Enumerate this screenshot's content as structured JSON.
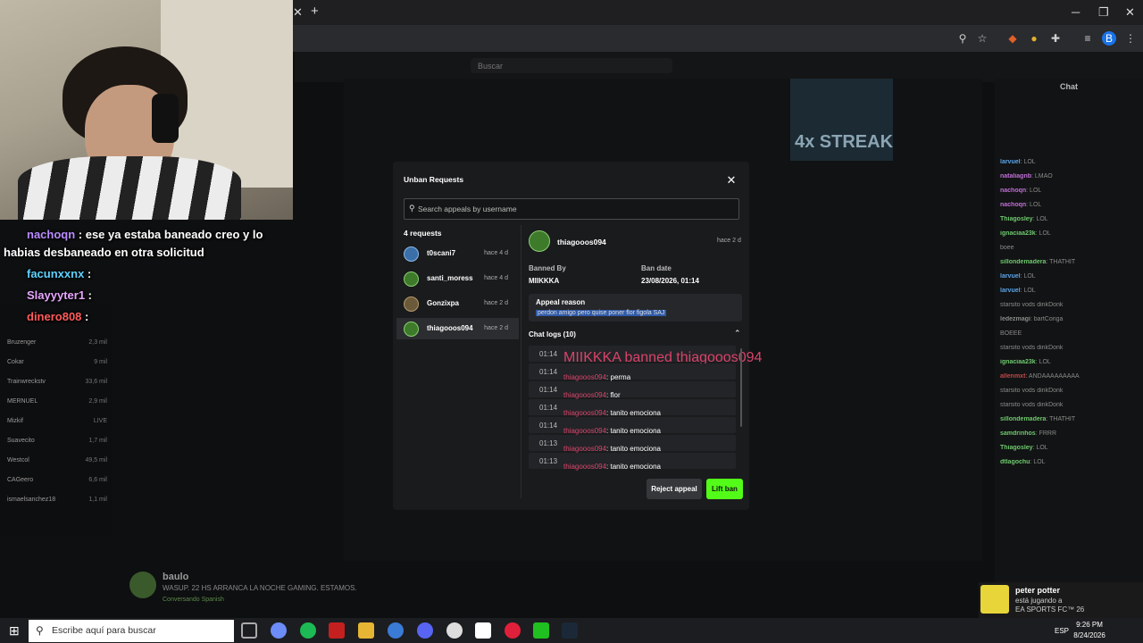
{
  "modal": {
    "title": "Unban Requests",
    "search_placeholder": "Search appeals by username",
    "request_count": "4 requests",
    "requests": [
      {
        "name": "t0scani7",
        "time": "hace 4 d"
      },
      {
        "name": "santi_moress",
        "time": "hace 4 d"
      },
      {
        "name": "Gonzixpa",
        "time": "hace 2 d"
      },
      {
        "name": "thiagooos094",
        "time": "hace 2 d"
      }
    ],
    "detail": {
      "name": "thiagooos094",
      "time": "hace 2 d",
      "banned_by_label": "Banned By",
      "banned_by": "MIIKKKA",
      "ban_date_label": "Ban date",
      "ban_date": "23/08/2026, 01:14",
      "appeal_reason_label": "Appeal reason",
      "appeal_reason": "perdon amigo pero quise poner flor figola SAJ",
      "chat_logs_label": "Chat logs (10)",
      "logs": [
        {
          "time": "01:14",
          "user": "",
          "text": "MIIKKKA banned thiagooos094"
        },
        {
          "time": "01:14",
          "user": "thiagooos094",
          "text": ": perma"
        },
        {
          "time": "01:14",
          "user": "thiagooos094",
          "text": ": flor"
        },
        {
          "time": "01:14",
          "user": "thiagooos094",
          "text": ": tanito emociona"
        },
        {
          "time": "01:14",
          "user": "thiagooos094",
          "text": ": tanito emociona"
        },
        {
          "time": "01:13",
          "user": "thiagooos094",
          "text": ": tanito emociona"
        },
        {
          "time": "01:13",
          "user": "thiagooos094",
          "text": ": tanito emociona"
        }
      ]
    },
    "reject_label": "Reject appeal",
    "lift_label": "Lift ban"
  },
  "overlay_chat": [
    {
      "user": "nachoqn",
      "text": " : ese ya estaba baneado creo y lo",
      "user_color": "#b98cff"
    },
    {
      "user": "",
      "text": "habias desbaneado en otra solicitud",
      "user_color": "#ffffff"
    },
    {
      "user": "facunxxnx",
      "text": " :",
      "user_color": "#5fd1ff"
    },
    {
      "user": "Slayyyter1",
      "text": " :",
      "user_color": "#e8a6ff"
    },
    {
      "user": "dinero808",
      "text": " :",
      "user_color": "#ff5b5b"
    }
  ],
  "chat": {
    "title": "Chat",
    "messages": [
      {
        "user": "larvuel",
        "text": ": LOL",
        "color": "#5aa4e8"
      },
      {
        "user": "nataliagnb",
        "text": ": LMAO",
        "color": "#c06fd6"
      },
      {
        "user": "nachoqn",
        "text": ": LOL",
        "color": "#c06fd6"
      },
      {
        "user": "nachoqn",
        "text": ": LOL",
        "color": "#c06fd6"
      },
      {
        "user": "Thiagosley",
        "text": ": LOL",
        "color": "#6ec96e"
      },
      {
        "user": "ignaciaa23k",
        "text": ": LOL",
        "color": "#6ec96e"
      },
      {
        "user": "",
        "text": "boee",
        "color": "#c04848"
      },
      {
        "user": "sillondemadera",
        "text": ": THATHIT",
        "color": "#6ec96e"
      },
      {
        "user": "larvuel",
        "text": ": LOL",
        "color": "#5aa4e8"
      },
      {
        "user": "larvuel",
        "text": ": LOL",
        "color": "#5aa4e8"
      },
      {
        "user": "",
        "text": "starsito vods dinkDonk",
        "color": "#8a8a8a"
      },
      {
        "user": "ledezmagi",
        "text": ": bartConga",
        "color": "#8a8a8a"
      },
      {
        "user": "",
        "text": "BOEEE",
        "color": "#c04848"
      },
      {
        "user": "",
        "text": "starsito vods dinkDonk",
        "color": "#8a8a8a"
      },
      {
        "user": "ignaciaa23k",
        "text": ": LOL",
        "color": "#6ec96e"
      },
      {
        "user": "allenmxt",
        "text": ": ANDAAAAAAAAA",
        "color": "#c04848"
      },
      {
        "user": "",
        "text": "starsito vods dinkDonk",
        "color": "#8a8a8a"
      },
      {
        "user": "",
        "text": "starsito vods dinkDonk",
        "color": "#8a8a8a"
      },
      {
        "user": "sillondemadera",
        "text": ": THATHIT",
        "color": "#6ec96e"
      },
      {
        "user": "samdrinhos",
        "text": ": FRRR",
        "color": "#6ec96e"
      },
      {
        "user": "Thiagosley",
        "text": ": LOL",
        "color": "#6ec96e"
      },
      {
        "user": "dtlagochu",
        "text": ": LOL",
        "color": "#6ec96e"
      }
    ]
  },
  "sidebar": {
    "items": [
      {
        "name": "Bruzenger",
        "count": "2,3 mil"
      },
      {
        "name": "Cokar",
        "count": "9 mil"
      },
      {
        "name": "Trainwreckstv",
        "count": "33,6 mil"
      },
      {
        "name": "MERNUEL",
        "count": "2,9 mil"
      },
      {
        "name": "Mizkif",
        "count": "LIVE"
      },
      {
        "name": "Suavecito",
        "count": "1,7 mil"
      },
      {
        "name": "Westcol",
        "count": "49,5 mil"
      },
      {
        "name": "CAGeero",
        "count": "6,6 mil"
      },
      {
        "name": "ismaelsanchez18",
        "count": "1,1 mil"
      }
    ]
  },
  "page": {
    "search_placeholder": "Buscar",
    "streak": "4x STREAK",
    "streamer_name": "baulo",
    "streamer_title": "WASUP. 22 HS ARRANCA LA NOCHE GAMING. ESTAMOS.",
    "streamer_sub": "Conversando  Spanish"
  },
  "notification": {
    "name": "peter potter",
    "line2": "está jugando a",
    "line3": "EA SPORTS FC™ 26"
  },
  "taskbar": {
    "search_placeholder": "Escribe aquí para buscar",
    "lang": "ESP",
    "time": "9:26 PM",
    "date": "8/24/2026"
  },
  "colors": {
    "accent": "#53fc18",
    "username_red": "#d8436a"
  }
}
